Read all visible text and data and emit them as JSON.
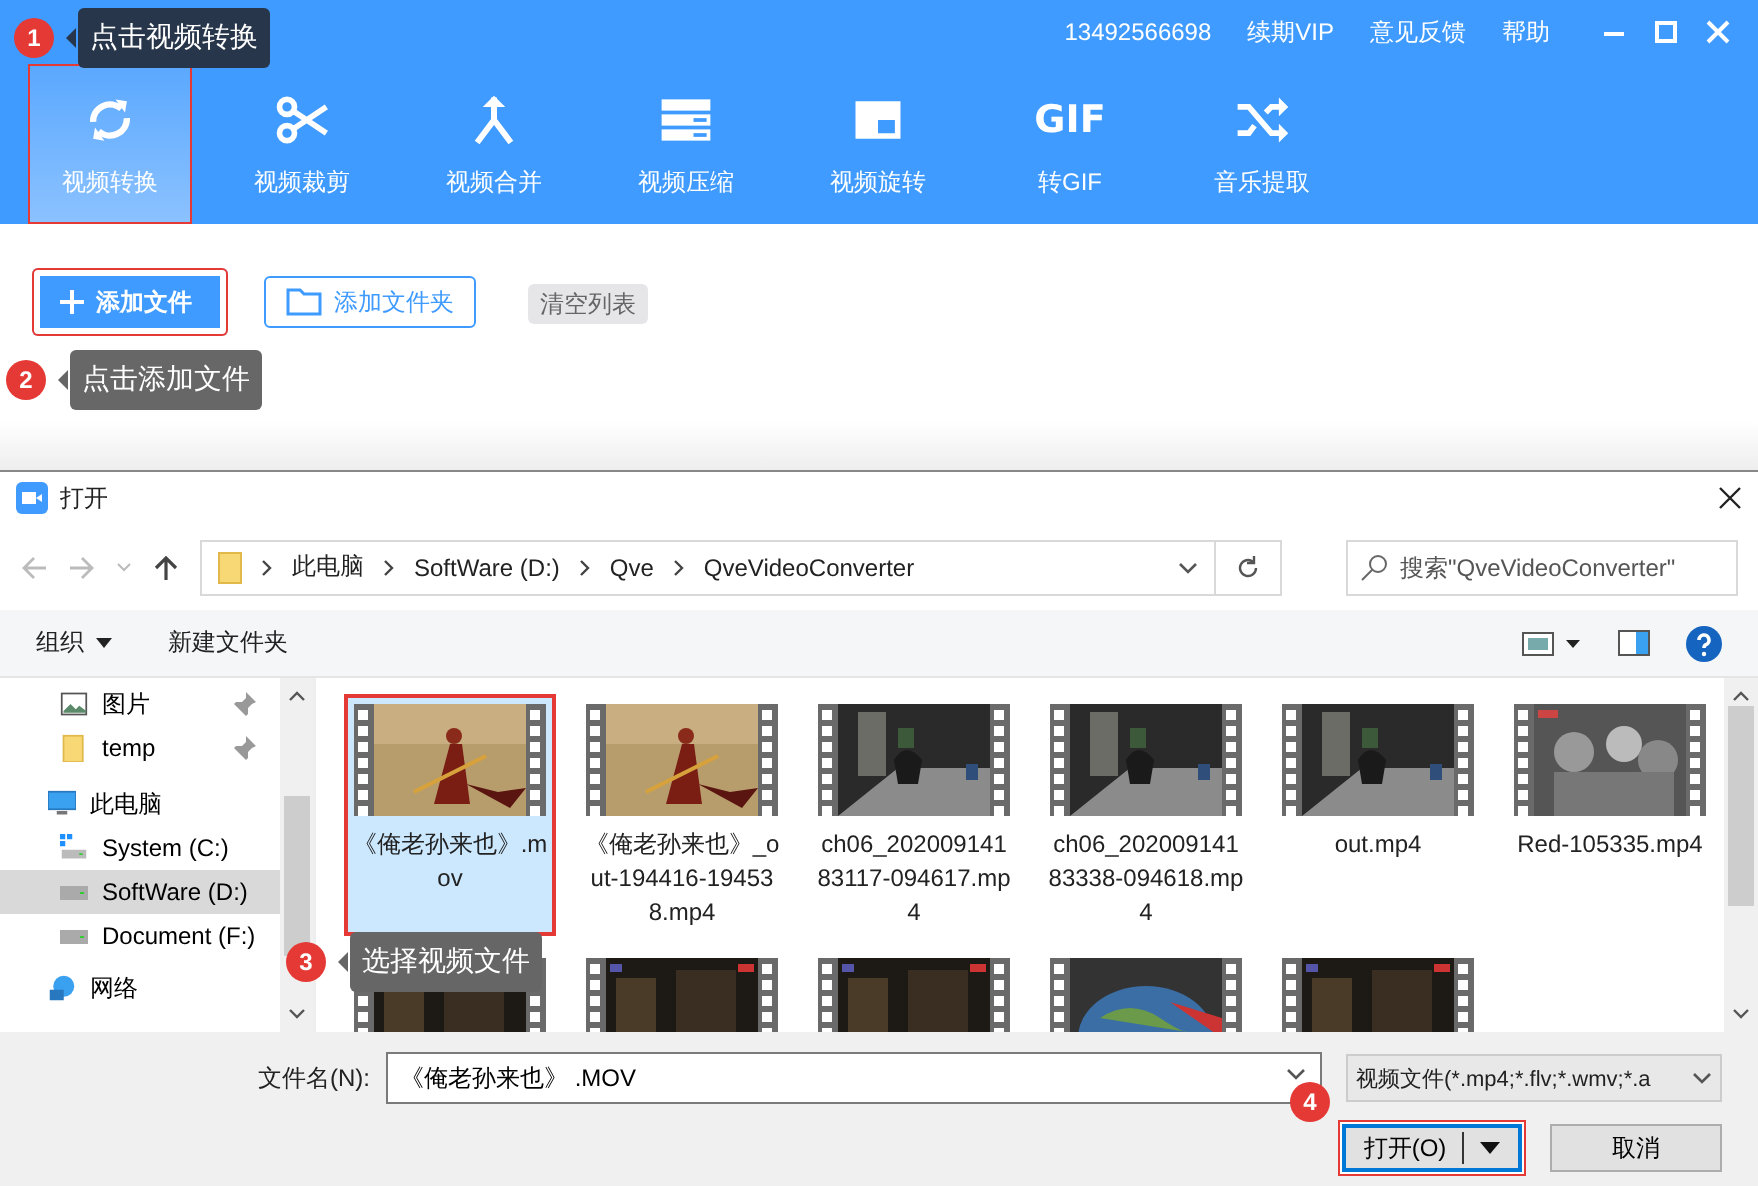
{
  "app": {
    "phone": "13492566698",
    "menu": [
      "续期VIP",
      "意见反馈",
      "帮助"
    ],
    "tools": [
      {
        "label": "视频转换",
        "selected": true,
        "highlighted": true
      },
      {
        "label": "视频裁剪",
        "selected": false,
        "highlighted": false
      },
      {
        "label": "视频合并",
        "selected": false,
        "highlighted": false
      },
      {
        "label": "视频压缩",
        "selected": false,
        "highlighted": false
      },
      {
        "label": "视频旋转",
        "selected": false,
        "highlighted": false
      },
      {
        "label": "转GIF",
        "icon_text": "GIF",
        "selected": false,
        "highlighted": false
      },
      {
        "label": "音乐提取",
        "selected": false,
        "highlighted": false
      }
    ],
    "actions": [
      {
        "label": "添加文件",
        "kind": "primary",
        "highlighted": true
      },
      {
        "label": "添加文件夹",
        "kind": "outline",
        "highlighted": false
      },
      {
        "label": "清空列表",
        "kind": "muted",
        "highlighted": false
      }
    ]
  },
  "dialog": {
    "title": "打开",
    "path": [
      "此电脑",
      "SoftWare (D:)",
      "Qve",
      "QveVideoConverter"
    ],
    "search": {
      "placeholder": "搜索\"QveVideoConverter\""
    },
    "commands": [
      "组织",
      "新建文件夹"
    ],
    "nav": [
      {
        "label": "图片",
        "kind": "pictures",
        "pinned": true,
        "selected": false
      },
      {
        "label": "temp",
        "kind": "folder",
        "pinned": true,
        "selected": false
      },
      {
        "label": "此电脑",
        "kind": "pc",
        "pinned": false,
        "selected": false
      },
      {
        "label": "System (C:)",
        "kind": "system-drive",
        "pinned": false,
        "selected": false
      },
      {
        "label": "SoftWare (D:)",
        "kind": "drive",
        "pinned": false,
        "selected": true
      },
      {
        "label": "Document (F:)",
        "kind": "drive",
        "pinned": false,
        "selected": false
      },
      {
        "label": "网络",
        "kind": "network",
        "pinned": false,
        "selected": false
      }
    ],
    "files": [
      {
        "name": "《俺老孙来也》.mov",
        "selected": true,
        "highlighted": true
      },
      {
        "name": "《俺老孙来也》_out-194416-194538.mp4",
        "selected": false,
        "highlighted": false
      },
      {
        "name": "ch06_20200914183117-094617.mp4",
        "selected": false,
        "highlighted": false
      },
      {
        "name": "ch06_20200914183338-094618.mp4",
        "selected": false,
        "highlighted": false
      },
      {
        "name": "out.mp4",
        "selected": false,
        "highlighted": false
      },
      {
        "name": "Red-105335.mp4",
        "selected": false,
        "highlighted": false
      },
      {
        "selected": false,
        "highlighted": false
      },
      {
        "selected": false,
        "highlighted": false
      },
      {
        "selected": false,
        "highlighted": false
      },
      {
        "selected": false,
        "highlighted": false
      },
      {
        "selected": false,
        "highlighted": false
      }
    ],
    "filename_label": "文件名(N):",
    "filename": "《俺老孙来也》 .MOV",
    "filter": "视频文件(*.mp4;*.flv;*.wmv;*.a",
    "buttons": [
      {
        "label": "打开(O)",
        "kind": "split",
        "highlighted": true
      },
      {
        "label": "取消",
        "kind": "plain",
        "highlighted": false
      }
    ]
  },
  "annotations": [
    {
      "number": "1",
      "text": "点击视频转换"
    },
    {
      "number": "2",
      "text": "点击添加文件"
    },
    {
      "number": "3",
      "text": "选择视频文件"
    },
    {
      "number": "4"
    }
  ]
}
